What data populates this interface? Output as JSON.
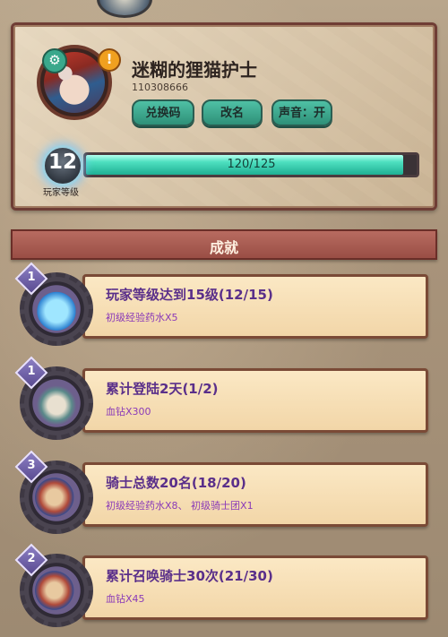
{
  "profile": {
    "name": "迷糊的狸猫护士",
    "id": "110308666",
    "buttons": {
      "redeem": "兑换码",
      "rename": "改名",
      "sound": "声音：开"
    },
    "level": "12",
    "level_label": "玩家等级",
    "exp_text": "120/125",
    "exp_fraction": 0.96,
    "settings_icon": "gear-icon",
    "alert_icon": "exclamation-icon",
    "alert_glyph": "!"
  },
  "achievements": {
    "title": "成就",
    "items": [
      {
        "count": "1",
        "title": "玩家等级达到15级(12/15)",
        "reward": "初级经验药水X5",
        "icon": "potion-flask-icon"
      },
      {
        "count": "1",
        "title": "累计登陆2天(1/2)",
        "reward": "血钻X300",
        "icon": "castle-icon"
      },
      {
        "count": "3",
        "title": "骑士总数20名(18/20)",
        "reward": "初级经验药水X8、 初级骑士团X1",
        "icon": "knights-icon"
      },
      {
        "count": "2",
        "title": "累计召唤骑士30次(21/30)",
        "reward": "血钻X45",
        "icon": "knights-icon"
      }
    ]
  }
}
